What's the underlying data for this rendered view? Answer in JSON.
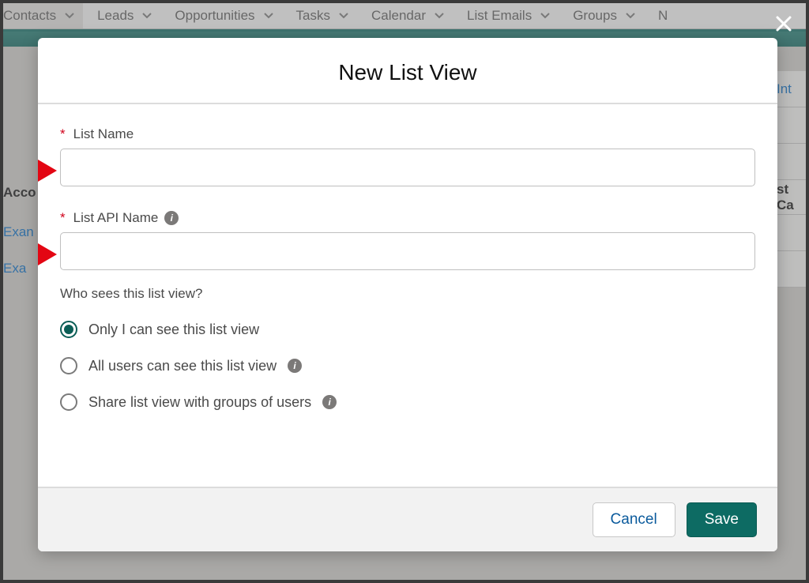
{
  "nav": {
    "items": [
      {
        "label": "Contacts"
      },
      {
        "label": "Leads"
      },
      {
        "label": "Opportunities"
      },
      {
        "label": "Tasks"
      },
      {
        "label": "Calendar"
      },
      {
        "label": "List Emails"
      },
      {
        "label": "Groups"
      },
      {
        "label": "N"
      }
    ]
  },
  "background": {
    "acc_header": "Acco",
    "link1": "Exan",
    "link2": "Exa",
    "right_int": "Int",
    "right_cap": "st Ca"
  },
  "modal": {
    "title": "New List View",
    "list_name_label": "List Name",
    "list_api_label": "List API Name",
    "question": "Who sees this list view?",
    "options": [
      {
        "label": "Only I can see this list view",
        "info": false,
        "checked": true
      },
      {
        "label": "All users can see this list view",
        "info": true,
        "checked": false
      },
      {
        "label": "Share list view with groups of users",
        "info": true,
        "checked": false
      }
    ],
    "cancel": "Cancel",
    "save": "Save"
  }
}
